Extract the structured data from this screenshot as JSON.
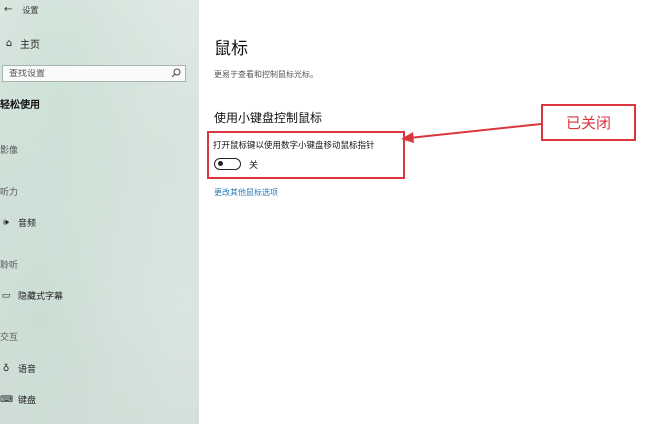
{
  "window": {
    "title": "设置",
    "back_icon": "back-arrow-icon"
  },
  "sidebar": {
    "home_label": "主页",
    "home_icon": "home-icon",
    "search_placeholder": "查找设置",
    "section_title": "轻松使用",
    "groups": [
      {
        "label": "影像"
      },
      {
        "label": "听力",
        "items": [
          {
            "label": "音频",
            "icon": "speaker-icon"
          }
        ]
      },
      {
        "label": "聆听",
        "items": [
          {
            "label": "隐藏式字幕",
            "icon": "captions-icon"
          }
        ]
      },
      {
        "label": "交互",
        "items": [
          {
            "label": "语音",
            "icon": "microphone-icon"
          },
          {
            "label": "键盘",
            "icon": "keyboard-icon"
          }
        ]
      }
    ]
  },
  "main": {
    "title": "鼠标",
    "description": "更易于查看和控制鼠标光标。",
    "subsection_title": "使用小键盘控制鼠标",
    "toggle_label": "打开鼠标键以使用数字小键盘移动鼠标指针",
    "toggle_state": "关",
    "toggle_on": false,
    "more_link": "更改其他鼠标选项"
  },
  "annotation": {
    "callout_text": "已关闭",
    "color": "#d9363e"
  }
}
